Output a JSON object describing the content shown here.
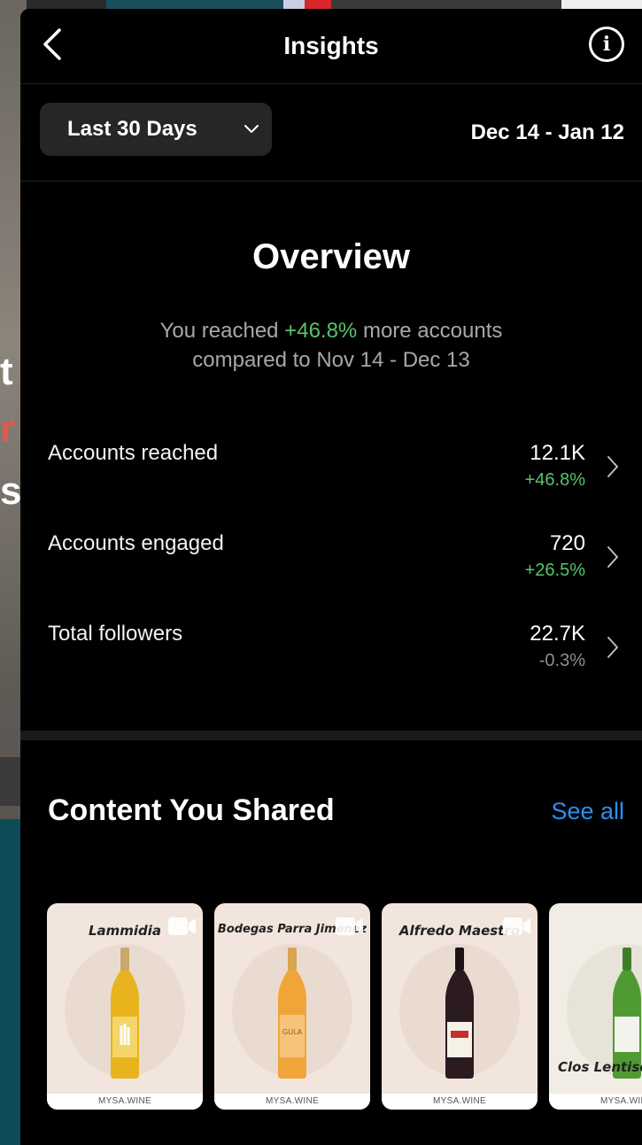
{
  "header": {
    "title": "Insights",
    "info_icon": "info-icon",
    "back_icon": "chevron-left-icon"
  },
  "range": {
    "selector_label": "Last 30 Days",
    "date_range": "Dec 14 - Jan 12"
  },
  "overview": {
    "title": "Overview",
    "sub_prefix": "You reached ",
    "sub_change": "+46.8%",
    "sub_mid": " more accounts",
    "sub_line2": "compared to Nov 14 - Dec 13"
  },
  "metrics": [
    {
      "label": "Accounts reached",
      "value": "12.1K",
      "change": "+46.8%",
      "trend": "positive"
    },
    {
      "label": "Accounts engaged",
      "value": "720",
      "change": "+26.5%",
      "trend": "positive"
    },
    {
      "label": "Total followers",
      "value": "22.7K",
      "change": "-0.3%",
      "trend": "negative"
    }
  ],
  "content_shared": {
    "title": "Content You Shared",
    "see_all": "See all",
    "items": [
      {
        "name": "Lammidia",
        "brand": "MYSA.WINE",
        "wine_color": "#e8b31d"
      },
      {
        "name": "Bodegas Parra Jimenez",
        "brand": "MYSA.WINE",
        "wine_color": "#f0a539"
      },
      {
        "name": "Alfredo Maestro",
        "brand": "MYSA.WINE",
        "wine_color": "#2b1a20"
      },
      {
        "name": "Clos Lentiscus",
        "brand": "MYSA.WINE",
        "wine_color": "#4f9b32"
      }
    ]
  },
  "colors": {
    "positive": "#58c36b",
    "link": "#2b8ff3",
    "background": "#000000"
  }
}
